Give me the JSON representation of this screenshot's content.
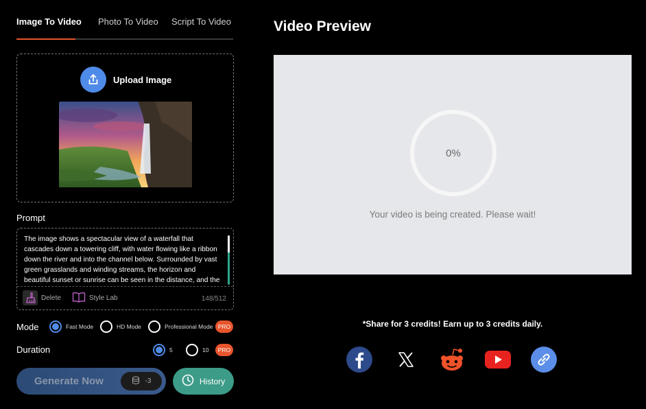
{
  "tabs": [
    {
      "label": "Image To Video",
      "active": true
    },
    {
      "label": "Photo To Video",
      "active": false
    },
    {
      "label": "Script To Video",
      "active": false
    }
  ],
  "upload": {
    "label": "Upload Image"
  },
  "prompt": {
    "label": "Prompt",
    "text": "The image shows a spectacular view of a waterfall that cascades down a towering cliff, with water flowing like a ribbon down the river and into the channel below. Surrounded by vast green grasslands and winding streams, the horizon and beautiful sunset or sunrise can be seen in the distance, and the",
    "delete_label": "Delete",
    "style_lab_label": "Style Lab",
    "char_count": "148/512"
  },
  "mode": {
    "label": "Mode",
    "options": [
      {
        "label": "Fast Mode",
        "selected": true
      },
      {
        "label": "HD Mode",
        "selected": false
      },
      {
        "label": "Professional Mode",
        "selected": false
      }
    ],
    "pro_badge": "PRO"
  },
  "duration": {
    "label": "Duration",
    "options": [
      {
        "label": "5",
        "selected": true
      },
      {
        "label": "10",
        "selected": false
      }
    ],
    "pro_badge": "PRO"
  },
  "generate": {
    "label": "Generate Now",
    "credits": "-3"
  },
  "history": {
    "label": "History"
  },
  "preview": {
    "title": "Video Preview",
    "progress": "0%",
    "status": "Your video is being created. Please wait!"
  },
  "share": {
    "text": "*Share for 3 credits! Earn up to 3 credits daily.",
    "icons": [
      "facebook-icon",
      "x-icon",
      "reddit-icon",
      "youtube-icon",
      "link-icon"
    ]
  },
  "colors": {
    "accent_orange": "#e8542c",
    "accent_blue": "#4f8be8",
    "history_green": "#3c9c88"
  }
}
